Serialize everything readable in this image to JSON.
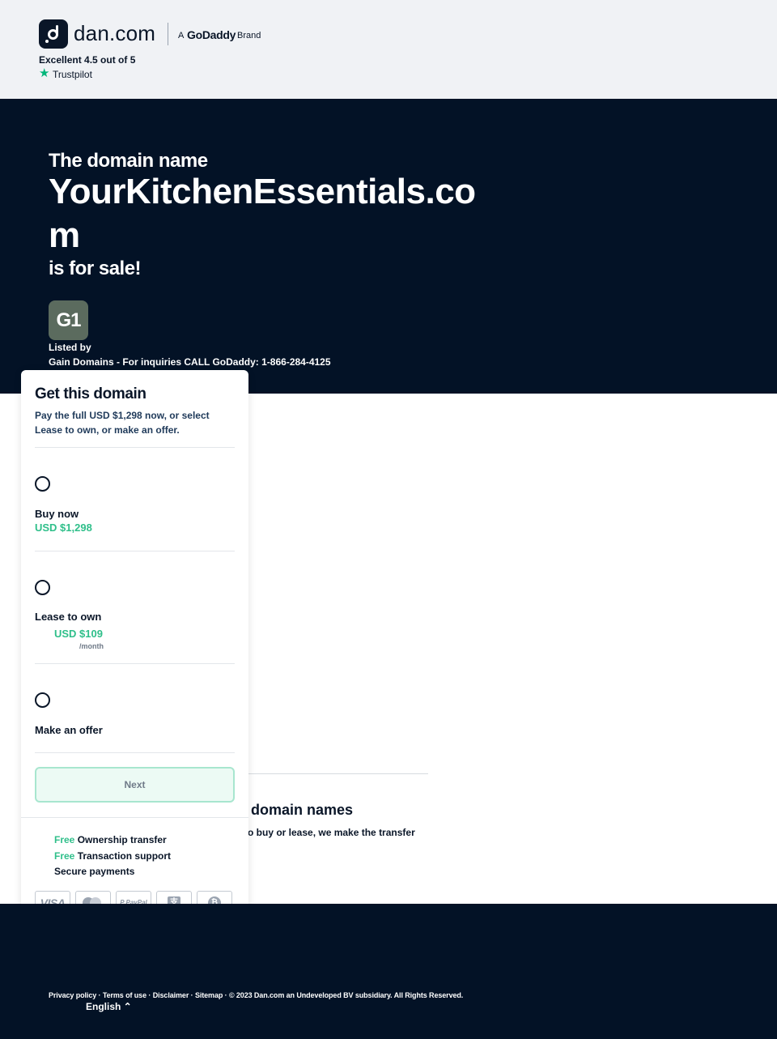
{
  "header": {
    "logo_text": "dan.com",
    "brand_prefix": "A",
    "brand_name": "GoDaddy",
    "brand_suffix": "Brand",
    "trustpilot_rating": "Excellent 4.5 out of 5",
    "trustpilot_name": "Trustpilot",
    "star_icon": "★"
  },
  "hero": {
    "pre_title": "The domain name",
    "domain": "YourKitchenEssentials.com",
    "post_title": "is for sale!",
    "seller_badge": "G1",
    "listed_by_label": "Listed by",
    "seller_name": "Gain Domains - For inquiries CALL GoDaddy: 1-866-284-4125"
  },
  "card": {
    "title": "Get this domain",
    "description": "Pay the full USD $1,298 now, or select Lease to own, or make an offer.",
    "options": [
      {
        "label": "Buy now",
        "price": "USD $1,298",
        "unit": ""
      },
      {
        "label": "Lease to own",
        "price": "USD $109",
        "unit": "/month"
      },
      {
        "label": "Make an offer",
        "price": "",
        "unit": ""
      }
    ],
    "next_button": "Next",
    "features": [
      {
        "free": "Free",
        "text": "Ownership transfer"
      },
      {
        "free": "Free",
        "text": "Transaction support"
      },
      {
        "free": "",
        "text": "Secure payments"
      }
    ],
    "payment_methods": [
      "VISA",
      "mastercard",
      "PayPal",
      "alipay",
      "bitcoin"
    ],
    "paypal_label": "P PayPal",
    "alipay_glyph": "支",
    "bitcoin_glyph": "₿"
  },
  "background": {
    "heading": "domain names",
    "subtext": "o buy or lease, we make the transfer"
  },
  "footer": {
    "links": [
      "Privacy policy",
      "Terms of use",
      "Disclaimer",
      "Sitemap"
    ],
    "separator": " · ",
    "copyright": "© 2023 Dan.com an Undeveloped BV subsidiary. All Rights Reserved.",
    "language": "English ⌃"
  },
  "colors": {
    "navy": "#031226",
    "accent_green": "#2fbf8a",
    "topbar_bg": "#f0f2f5",
    "seller_badge_bg": "#5b6b5e"
  }
}
